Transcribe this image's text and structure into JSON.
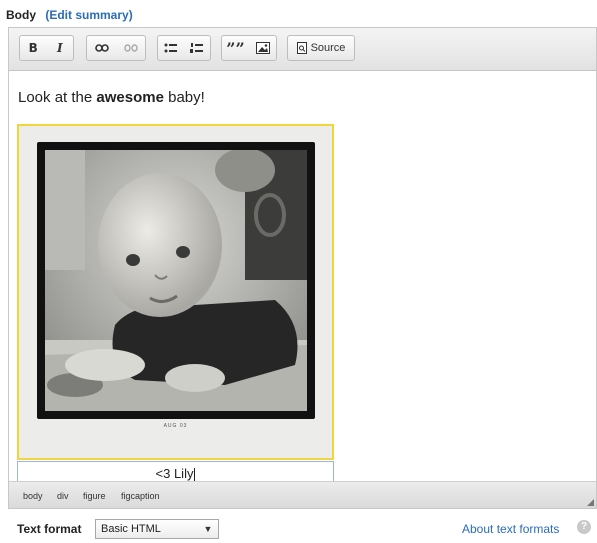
{
  "field": {
    "label": "Body",
    "edit_summary": "(Edit summary)"
  },
  "toolbar": {
    "bold": "B",
    "italic": "I",
    "source": "Source",
    "icons": [
      "bold-icon",
      "italic-icon",
      "link-icon",
      "unlink-icon",
      "bulleted-list-icon",
      "numbered-list-icon",
      "blockquote-icon",
      "image-icon",
      "source-icon"
    ]
  },
  "content": {
    "before": "Look at the ",
    "bold": "awesome",
    "after": " baby!",
    "photo_stamp": "AUG  03",
    "caption": "<3 Lily"
  },
  "path_bar": [
    "body",
    "div",
    "figure",
    "figcaption"
  ],
  "text_format": {
    "label": "Text format",
    "selected": "Basic HTML",
    "about_link": "About text formats"
  },
  "colors": {
    "link": "#2a6db8",
    "figure_highlight": "#f2d53c",
    "caption_border": "#9ab6da"
  }
}
